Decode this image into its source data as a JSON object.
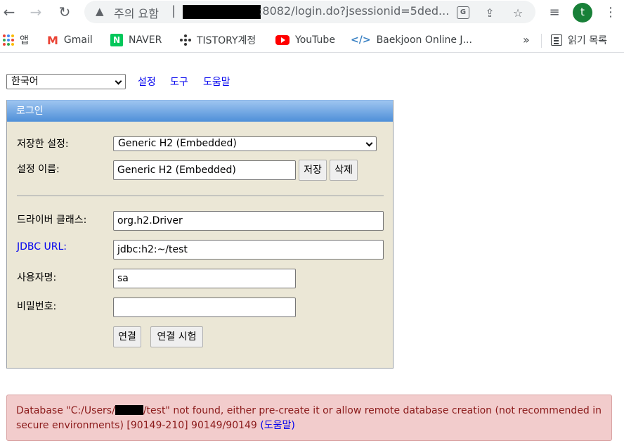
{
  "browser": {
    "security_label": "주의 요함",
    "url_separator": "|",
    "url_visible": ":8082/login.do?jsessionid=5ded...",
    "avatar_initial": "t"
  },
  "bookmarks": [
    {
      "label": "앱",
      "icon": "apps-grid-icon"
    },
    {
      "label": "Gmail",
      "icon": "gmail-icon"
    },
    {
      "label": "NAVER",
      "icon": "naver-icon"
    },
    {
      "label": "TISTORY계정",
      "icon": "tistory-icon"
    },
    {
      "label": "YouTube",
      "icon": "youtube-icon"
    },
    {
      "label": "Baekjoon Online J...",
      "icon": "code-icon"
    }
  ],
  "bookmarks_more": "»",
  "reading_list_label": "읽기 목록",
  "top_nav": {
    "language": "한국어",
    "links": [
      "설정",
      "도구",
      "도움말"
    ]
  },
  "login": {
    "title": "로그인",
    "saved_settings_label": "저장한 설정:",
    "saved_settings_value": "Generic H2 (Embedded)",
    "setting_name_label": "설정 이름:",
    "setting_name_value": "Generic H2 (Embedded)",
    "save_button": "저장",
    "delete_button": "삭제",
    "driver_class_label": "드라이버 클래스:",
    "driver_class_value": "org.h2.Driver",
    "jdbc_url_label": "JDBC URL:",
    "jdbc_url_value": "jdbc:h2:~/test",
    "username_label": "사용자명:",
    "username_value": "sa",
    "password_label": "비밀번호:",
    "password_value": "",
    "connect_button": "연결",
    "test_connection_button": "연결 시험"
  },
  "error": {
    "text_before": "Database \"C:/Users/",
    "text_after": "/test\" not found, either pre-create it or allow remote database creation (not recommended in secure environments) [90149-210] 90149/90149 ",
    "help_link": "(도움말)"
  },
  "colors": {
    "panel_bg": "#ebe7d6",
    "title_bar": "#4e8fd8",
    "error_bg": "#f2cccc",
    "link": "#0000ee"
  }
}
